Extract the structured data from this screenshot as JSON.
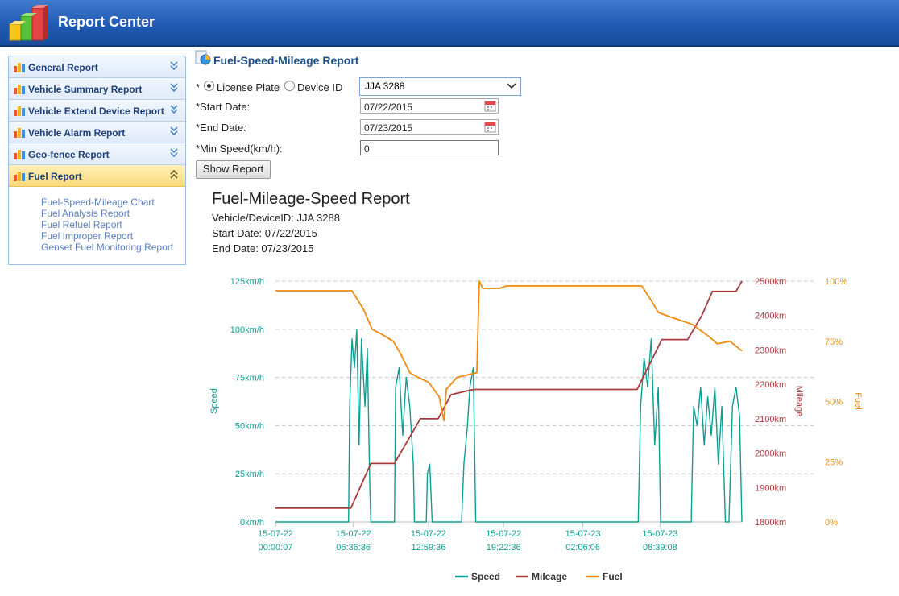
{
  "header": {
    "title": "Report Center"
  },
  "sidebar": {
    "items": [
      {
        "label": "General Report"
      },
      {
        "label": "Vehicle Summary Report"
      },
      {
        "label": "Vehicle Extend Device Report"
      },
      {
        "label": "Vehicle Alarm Report"
      },
      {
        "label": "Geo-fence Report"
      },
      {
        "label": "Fuel Report"
      }
    ],
    "fuel_sub": [
      "Fuel-Speed-Mileage Chart",
      "Fuel Analysis Report",
      "Fuel Refuel Report",
      "Fuel Improper Report",
      "Genset Fuel Monitoring Report"
    ]
  },
  "form": {
    "title": "Fuel-Speed-Mileage Report",
    "required_mark": "*",
    "license_plate": "License Plate",
    "device_id": "Device ID",
    "vehicle_value": "JJA 3288",
    "start_label": "*Start Date:",
    "start_value": "07/22/2015",
    "end_label": "*End Date:",
    "end_value": "07/23/2015",
    "minspeed_label": "*Min Speed(km/h):",
    "minspeed_value": "0",
    "show_button": "Show Report"
  },
  "report": {
    "title": "Fuel-Mileage-Speed Report",
    "vehicle_line": "Vehicle/DeviceID: JJA 3288",
    "start_line": "Start Date: 07/22/2015",
    "end_line": "End Date: 07/23/2015"
  },
  "colors": {
    "speed": "#0e9e93",
    "mileage": "#a83c3c",
    "fuel": "#f08a12"
  },
  "chart_data": {
    "type": "line",
    "x_ticks": [
      "15-07-22 00:00:07",
      "15-07-22 06:36:36",
      "15-07-22 12:59:36",
      "15-07-22 19:22:36",
      "15-07-23 02:06:06",
      "15-07-23 08:39:08"
    ],
    "x_tick_hours": [
      0,
      6.61,
      12.99,
      19.37,
      26.1,
      32.65
    ],
    "x_end_hours": 39.6,
    "axes": {
      "speed": {
        "label": "Speed",
        "ticks": [
          "0km/h",
          "25km/h",
          "50km/h",
          "75km/h",
          "100km/h",
          "125km/h"
        ],
        "range": [
          0,
          125
        ]
      },
      "mileage": {
        "label": "Mileage",
        "ticks": [
          "1800km",
          "1900km",
          "2000km",
          "2100km",
          "2200km",
          "2300km",
          "2400km",
          "2500km"
        ],
        "range": [
          1800,
          2500
        ]
      },
      "fuel": {
        "label": "Fuel",
        "ticks": [
          "0%",
          "25%",
          "50%",
          "75%",
          "100%"
        ],
        "range": [
          0,
          100
        ]
      }
    },
    "series": [
      {
        "name": "Speed",
        "axis": "speed",
        "points": [
          [
            0,
            0
          ],
          [
            6.2,
            0
          ],
          [
            6.3,
            60
          ],
          [
            6.5,
            95
          ],
          [
            6.7,
            80
          ],
          [
            6.9,
            100
          ],
          [
            7.1,
            40
          ],
          [
            7.3,
            95
          ],
          [
            7.6,
            60
          ],
          [
            7.8,
            90
          ],
          [
            8.0,
            20
          ],
          [
            8.1,
            0
          ],
          [
            10.1,
            0
          ],
          [
            10.2,
            70
          ],
          [
            10.5,
            80
          ],
          [
            10.8,
            45
          ],
          [
            11.1,
            75
          ],
          [
            11.4,
            60
          ],
          [
            11.7,
            30
          ],
          [
            11.8,
            0
          ],
          [
            12.8,
            0
          ],
          [
            12.9,
            25
          ],
          [
            13.1,
            30
          ],
          [
            13.3,
            0
          ],
          [
            14.0,
            0
          ],
          [
            15.8,
            0
          ],
          [
            16.0,
            30
          ],
          [
            16.3,
            50
          ],
          [
            16.5,
            70
          ],
          [
            16.8,
            80
          ],
          [
            17.0,
            0
          ],
          [
            30.8,
            0
          ],
          [
            31.0,
            60
          ],
          [
            31.3,
            85
          ],
          [
            31.6,
            70
          ],
          [
            31.9,
            95
          ],
          [
            32.2,
            40
          ],
          [
            32.5,
            70
          ],
          [
            32.7,
            0
          ],
          [
            35.3,
            0
          ],
          [
            35.5,
            60
          ],
          [
            35.8,
            50
          ],
          [
            36.1,
            70
          ],
          [
            36.4,
            40
          ],
          [
            36.7,
            65
          ],
          [
            37.0,
            45
          ],
          [
            37.3,
            70
          ],
          [
            37.6,
            30
          ],
          [
            37.9,
            60
          ],
          [
            38.2,
            0
          ],
          [
            38.5,
            0
          ],
          [
            38.8,
            60
          ],
          [
            39.1,
            70
          ],
          [
            39.4,
            55
          ],
          [
            39.6,
            0
          ]
        ]
      },
      {
        "name": "Mileage",
        "axis": "mileage",
        "points": [
          [
            0,
            1840
          ],
          [
            6.4,
            1840
          ],
          [
            8.1,
            1970
          ],
          [
            10.1,
            1970
          ],
          [
            12.3,
            2100
          ],
          [
            13.8,
            2100
          ],
          [
            14.9,
            2170
          ],
          [
            16.8,
            2185
          ],
          [
            30.7,
            2185
          ],
          [
            32.8,
            2330
          ],
          [
            35.0,
            2330
          ],
          [
            36.2,
            2400
          ],
          [
            37.1,
            2470
          ],
          [
            39.1,
            2470
          ],
          [
            39.6,
            2500
          ]
        ]
      },
      {
        "name": "Fuel",
        "axis": "fuel",
        "points": [
          [
            0,
            96
          ],
          [
            6.5,
            96
          ],
          [
            7.5,
            88
          ],
          [
            8.2,
            80
          ],
          [
            9.0,
            78
          ],
          [
            10.0,
            75
          ],
          [
            10.6,
            70
          ],
          [
            11.4,
            62
          ],
          [
            12.1,
            60
          ],
          [
            13.0,
            58
          ],
          [
            13.9,
            52
          ],
          [
            14.3,
            42
          ],
          [
            14.5,
            55
          ],
          [
            15.4,
            60
          ],
          [
            17.1,
            62
          ],
          [
            17.3,
            100
          ],
          [
            17.6,
            97
          ],
          [
            19.0,
            97
          ],
          [
            19.6,
            98
          ],
          [
            31.1,
            98
          ],
          [
            31.9,
            92
          ],
          [
            32.5,
            87
          ],
          [
            33.6,
            85
          ],
          [
            35.4,
            82
          ],
          [
            36.8,
            77
          ],
          [
            37.5,
            74
          ],
          [
            38.6,
            75
          ],
          [
            39.6,
            71
          ]
        ]
      }
    ]
  }
}
